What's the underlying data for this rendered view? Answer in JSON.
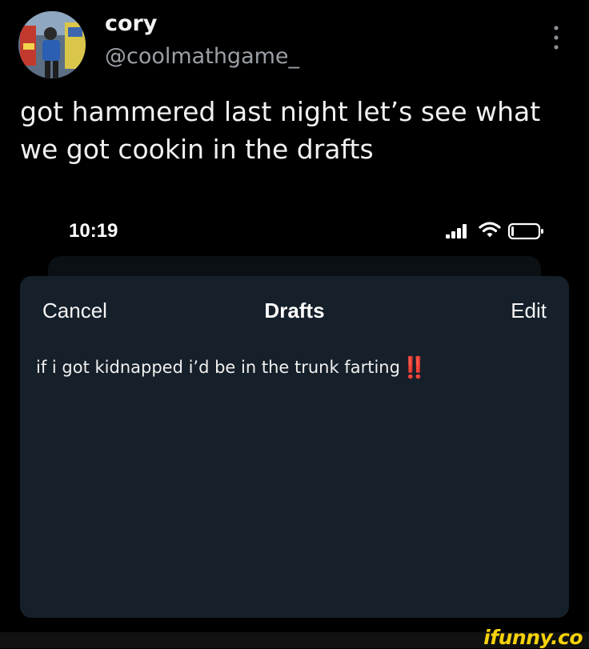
{
  "tweet": {
    "author_name": "cory",
    "author_handle": "@coolmathgame_",
    "text": "got hammered last night let’s see what we got cookin in the drafts",
    "more_icon": "vertical-dots-icon"
  },
  "phone": {
    "status_time": "10:19",
    "status_icons": [
      "signal-icon",
      "wifi-icon",
      "battery-icon"
    ],
    "drafts_sheet": {
      "cancel_label": "Cancel",
      "title": "Drafts",
      "edit_label": "Edit",
      "drafts": [
        {
          "text": "if i got kidnapped i’d be in the trunk farting",
          "emoji": "‼️"
        }
      ]
    }
  },
  "watermark": {
    "text": "ifunny.co"
  },
  "colors": {
    "background": "#000000",
    "sheet": "#16202a",
    "handle": "#9aa0a6",
    "alert_red": "#e0302e",
    "watermark_yellow": "#f5d20a"
  }
}
